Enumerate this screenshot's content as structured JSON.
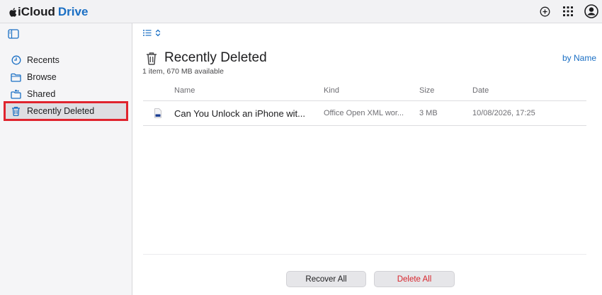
{
  "header": {
    "brand_icloud": "iCloud",
    "brand_drive": "Drive",
    "icons": [
      "apple-icon",
      "plus-circle-icon",
      "app-grid-icon",
      "account-icon"
    ]
  },
  "sidebar": {
    "items": [
      {
        "label": "Recents",
        "icon": "clock-icon"
      },
      {
        "label": "Browse",
        "icon": "folder-icon"
      },
      {
        "label": "Shared",
        "icon": "shared-folder-icon"
      },
      {
        "label": "Recently Deleted",
        "icon": "trash-icon",
        "active": true
      }
    ]
  },
  "main": {
    "title": "Recently Deleted",
    "subtitle": "1 item, 670 MB available",
    "sort_label": "by Name",
    "columns": [
      "Name",
      "Kind",
      "Size",
      "Date"
    ],
    "rows": [
      {
        "name": "Can You Unlock an iPhone wit...",
        "kind": "Office Open XML wor...",
        "size": "3 MB",
        "date": "10/08/2026, 17:25"
      }
    ],
    "buttons": {
      "recover_all": "Recover All",
      "delete_all": "Delete All"
    }
  },
  "colors": {
    "accent": "#1a6fc4",
    "highlight_border": "#e0242e",
    "destructive": "#d7242c",
    "sidebar_bg": "#f5f5f7"
  }
}
